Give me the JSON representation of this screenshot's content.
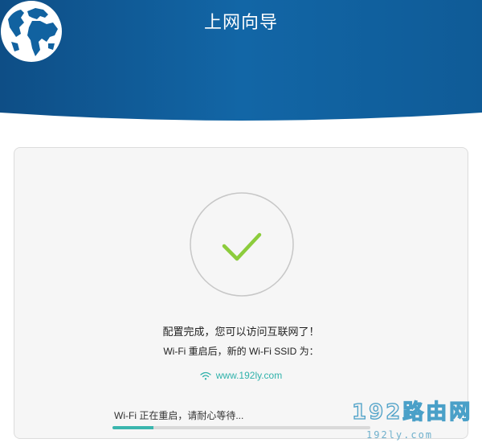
{
  "header": {
    "title": "上网向导",
    "icon": "globe-icon",
    "gradient_colors": [
      "#0e4e86",
      "#1266a6",
      "#0f5b97"
    ]
  },
  "status": {
    "icon": "check-icon",
    "check_color": "#8ccc3c",
    "complete_text": "配置完成，您可以访问互联网了！",
    "ssid_notice": "Wi-Fi 重启后，新的 Wi-Fi SSID 为：",
    "ssid_icon": "wifi-icon",
    "ssid": "www.192ly.com",
    "ssid_color": "#30b2ab"
  },
  "progress": {
    "label": "Wi-Fi 正在重启，请耐心等待...",
    "fraction": 0.16,
    "fill_color": "#3ab6ae"
  },
  "watermark": {
    "main": "192路由网",
    "sub": "192ly.com"
  }
}
